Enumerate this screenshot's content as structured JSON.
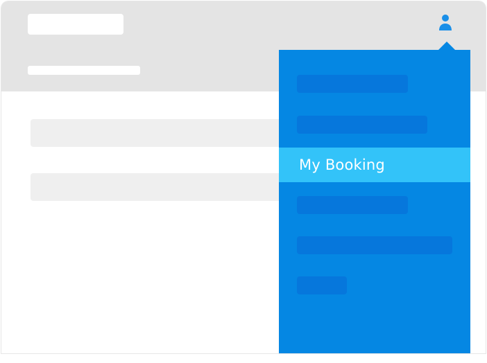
{
  "menu": {
    "items": [
      {
        "label": ""
      },
      {
        "label": ""
      },
      {
        "label": "My Booking",
        "active": true
      },
      {
        "label": ""
      },
      {
        "label": ""
      },
      {
        "label": ""
      }
    ]
  },
  "icons": {
    "user": "user-icon",
    "caret": "caret-up-icon"
  },
  "colors": {
    "header_bg": "#e4e4e4",
    "dropdown_bg": "#0587e3",
    "dropdown_item_placeholder": "#0677dc",
    "active_item_bg": "#33c3f9",
    "user_icon": "#1a8fe8"
  }
}
